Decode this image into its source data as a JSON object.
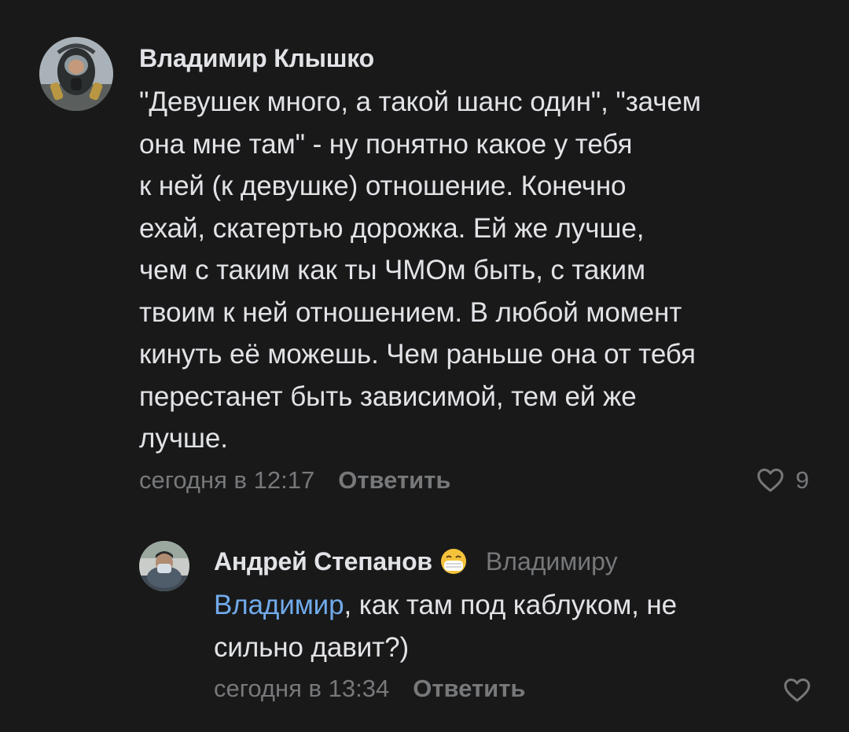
{
  "comments": [
    {
      "author": "Владимир Клышко",
      "text_lines": [
        "\"Девушек много, а такой шанс один\", \"зачем",
        "она мне там\" - ну понятно какое у тебя",
        "к ней (к девушке) отношение. Конечно",
        "ехай, скатертью дорожка. Ей же лучше,",
        "чем с таким как ты ЧМОм быть, с таким",
        "твоим к ней отношением. В любой момент",
        "кинуть её можешь. Чем раньше она от тебя",
        "перестанет быть зависимой, тем ей же",
        "лучше."
      ],
      "time": "сегодня в 12:17",
      "reply_label": "Ответить",
      "likes": "9",
      "avatar_icon": "gas-mask-avatar"
    },
    {
      "author": "Андрей Степанов",
      "author_emoji": "face-with-medical-mask-icon",
      "reply_to": "Владимиру",
      "mention": "Владимир",
      "text_line1_rest": ", как там под каблуком, не",
      "text_line2": "сильно давит?)",
      "time": "сегодня в 13:34",
      "reply_label": "Ответить",
      "avatar_icon": "person-in-mask-avatar"
    }
  ],
  "colors": {
    "background": "#19191a",
    "text": "#e1e3e6",
    "secondary": "#76787a",
    "link": "#71aaeb"
  }
}
